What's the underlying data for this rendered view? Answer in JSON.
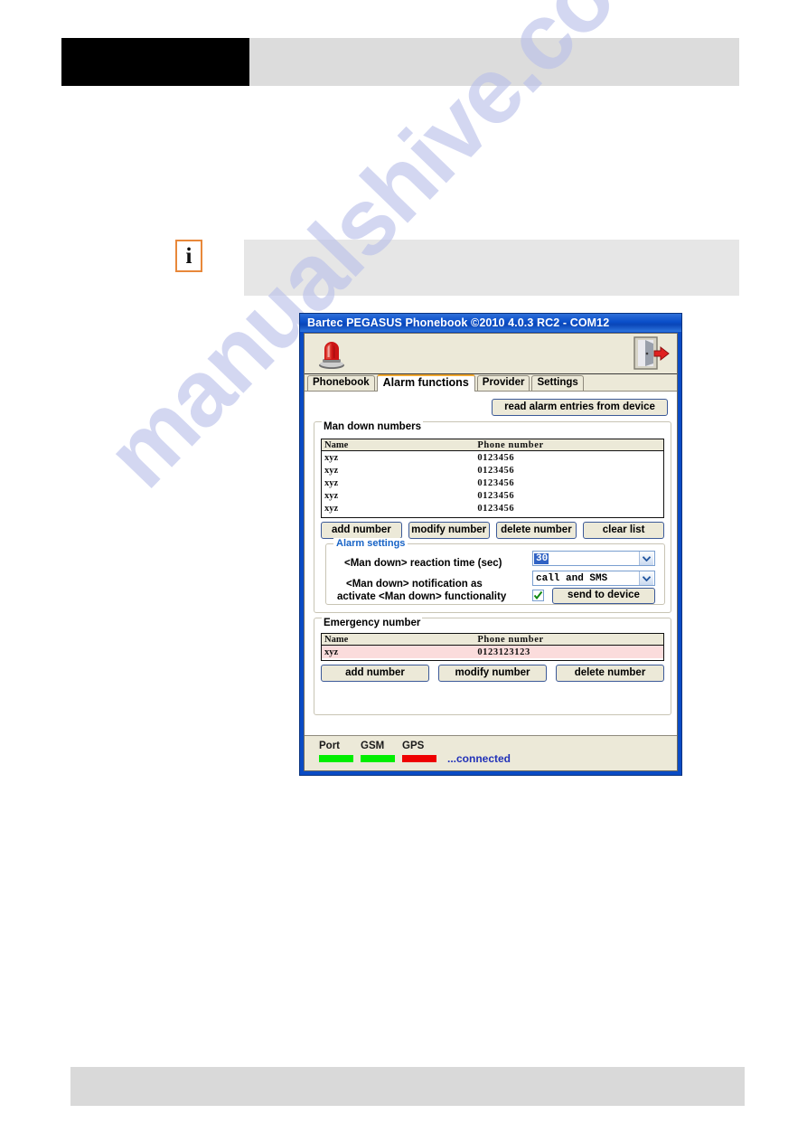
{
  "document": {
    "header": {
      "left_block": "",
      "right_block": ""
    },
    "note": {
      "icon": "info-icon",
      "icon_glyph": "i",
      "body": ""
    },
    "footer": {
      "text": ""
    },
    "watermark": "manualshive.com"
  },
  "app": {
    "title": "Bartec PEGASUS Phonebook ©2010 4.0.3 RC2 - COM12",
    "toolbar": {
      "alarm_beacon_icon": "alarm-beacon-icon",
      "exit_icon": "exit-door-icon"
    },
    "tabs": [
      {
        "label": "Phonebook",
        "active": false
      },
      {
        "label": "Alarm functions",
        "active": true
      },
      {
        "label": "Provider",
        "active": false
      },
      {
        "label": "Settings",
        "active": false
      }
    ],
    "read_button": "read alarm entries from device",
    "man_down": {
      "group_title": "Man down numbers",
      "columns": [
        "Name",
        "Phone number"
      ],
      "rows": [
        {
          "name": "xyz",
          "phone": "0123456"
        },
        {
          "name": "xyz",
          "phone": "0123456"
        },
        {
          "name": "xyz",
          "phone": "0123456"
        },
        {
          "name": "xyz",
          "phone": "0123456"
        },
        {
          "name": "xyz",
          "phone": "0123456"
        }
      ],
      "buttons": [
        "add number",
        "modify number",
        "delete number",
        "clear list"
      ]
    },
    "alarm_settings": {
      "group_title": "Alarm settings",
      "reaction_time_label": "<Man down> reaction time (sec)",
      "reaction_time_value": "30",
      "notification_label": "<Man down>  notification as",
      "notification_value": "call and SMS",
      "activate_label": "activate <Man down>  functionality",
      "activate_checked": true,
      "send_button": "send to device"
    },
    "emergency": {
      "group_title": "Emergency number",
      "columns": [
        "Name",
        "Phone number"
      ],
      "rows": [
        {
          "name": "xyz",
          "phone": "0123123123"
        }
      ],
      "buttons": [
        "add number",
        "modify number",
        "delete number"
      ]
    },
    "statusbar": {
      "indicators": [
        {
          "label": "Port",
          "color": "#00ee00"
        },
        {
          "label": "GSM",
          "color": "#00ee00"
        },
        {
          "label": "GPS",
          "color": "#ee0000"
        }
      ],
      "message": "...connected"
    },
    "colors": {
      "titlebar": "#0a4bc4",
      "dialog_face": "#ece9d8",
      "active_tab_accent": "#f0a830",
      "group_label_blue": "#1763c6",
      "highlight_row": "#fbdcdc",
      "status_ok": "#00ee00",
      "status_error": "#ee0000"
    }
  }
}
